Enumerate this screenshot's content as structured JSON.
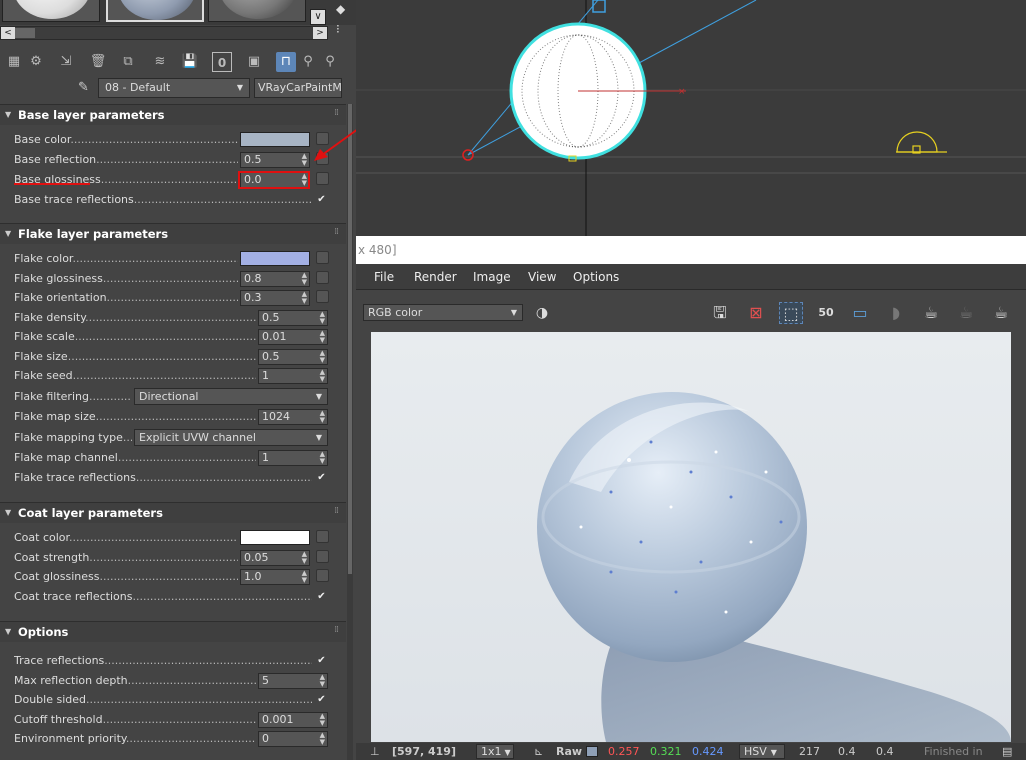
{
  "material": {
    "name": "08 - Default",
    "type": "VRayCarPaintMtl"
  },
  "base_layer": {
    "title": "Base layer parameters",
    "color_label": "Base color",
    "color": "#a7b4c4",
    "reflection_label": "Base reflection",
    "reflection": "0.5",
    "glossiness_label": "Base glossiness",
    "glossiness": "0.0",
    "trace_label": "Base trace reflections",
    "trace": true
  },
  "flake_layer": {
    "title": "Flake layer parameters",
    "color_label": "Flake color",
    "color": "#a3b0e4",
    "glossiness_label": "Flake glossiness",
    "glossiness": "0.8",
    "orientation_label": "Flake orientation",
    "orientation": "0.3",
    "density_label": "Flake density",
    "density": "0.5",
    "scale_label": "Flake scale",
    "scale": "0.01",
    "size_label": "Flake size",
    "size": "0.5",
    "seed_label": "Flake seed",
    "seed": "1",
    "filtering_label": "Flake filtering",
    "filtering": "Directional",
    "map_size_label": "Flake map size",
    "map_size": "1024",
    "mapping_type_label": "Flake mapping type",
    "mapping_type": "Explicit UVW channel",
    "map_channel_label": "Flake map channel",
    "map_channel": "1",
    "trace_label": "Flake trace reflections",
    "trace": true
  },
  "coat_layer": {
    "title": "Coat layer parameters",
    "color_label": "Coat color",
    "color": "#ffffff",
    "strength_label": "Coat strength",
    "strength": "0.05",
    "glossiness_label": "Coat glossiness",
    "glossiness": "1.0",
    "trace_label": "Coat trace reflections",
    "trace": true
  },
  "options": {
    "title": "Options",
    "trace_label": "Trace reflections",
    "trace": true,
    "max_depth_label": "Max reflection depth",
    "max_depth": "5",
    "double_sided_label": "Double sided",
    "double_sided": true,
    "cutoff_label": "Cutoff threshold",
    "cutoff": "0.001",
    "env_priority_label": "Environment priority",
    "env_priority": "0"
  },
  "frame_buffer": {
    "title_fragment": "x 480]",
    "menus": [
      "File",
      "Render",
      "Image",
      "View",
      "Options"
    ],
    "channel": "RGB color",
    "zoom_label": "50",
    "status": {
      "coords": "[597, 419]",
      "sample": "1x1",
      "mode": "Raw",
      "r": "0.257",
      "g": "0.321",
      "b": "0.424",
      "color_space": "HSV",
      "h": "217",
      "s": "0.4",
      "v": "0.4",
      "finished": "Finished in"
    }
  },
  "colors": {
    "highlight": "#e01010",
    "accent_blue": "#5d86b8",
    "r_value": "#ff5555",
    "g_value": "#55dd55",
    "b_value": "#6699ff"
  }
}
